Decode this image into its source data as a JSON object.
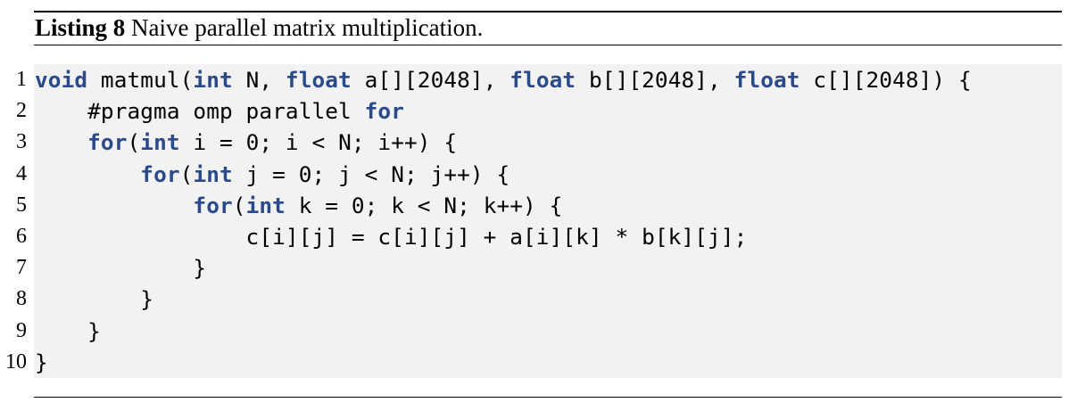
{
  "caption": {
    "label": "Listing",
    "number": "8",
    "text": "Naive parallel matrix multiplication."
  },
  "colors": {
    "keyword": "#2a4a8a",
    "code_background": "#f2f2f2",
    "text": "#000000"
  },
  "code_lines": [
    {
      "number": "1",
      "tokens": [
        {
          "t": "void",
          "kw": true
        },
        {
          "t": " matmul("
        },
        {
          "t": "int",
          "kw": true
        },
        {
          "t": " N, "
        },
        {
          "t": "float",
          "kw": true
        },
        {
          "t": " a[][2048], "
        },
        {
          "t": "float",
          "kw": true
        },
        {
          "t": " b[][2048], "
        },
        {
          "t": "float",
          "kw": true
        },
        {
          "t": " c[][2048]) {"
        }
      ]
    },
    {
      "number": "2",
      "tokens": [
        {
          "t": "    #pragma omp parallel "
        },
        {
          "t": "for",
          "kw": true
        }
      ]
    },
    {
      "number": "3",
      "tokens": [
        {
          "t": "    "
        },
        {
          "t": "for",
          "kw": true
        },
        {
          "t": "("
        },
        {
          "t": "int",
          "kw": true
        },
        {
          "t": " i = 0; i < N; i++) {"
        }
      ]
    },
    {
      "number": "4",
      "tokens": [
        {
          "t": "        "
        },
        {
          "t": "for",
          "kw": true
        },
        {
          "t": "("
        },
        {
          "t": "int",
          "kw": true
        },
        {
          "t": " j = 0; j < N; j++) {"
        }
      ]
    },
    {
      "number": "5",
      "tokens": [
        {
          "t": "            "
        },
        {
          "t": "for",
          "kw": true
        },
        {
          "t": "("
        },
        {
          "t": "int",
          "kw": true
        },
        {
          "t": " k = 0; k < N; k++) {"
        }
      ]
    },
    {
      "number": "6",
      "tokens": [
        {
          "t": "                c[i][j] = c[i][j] + a[i][k] * b[k][j];"
        }
      ]
    },
    {
      "number": "7",
      "tokens": [
        {
          "t": "            }"
        }
      ]
    },
    {
      "number": "8",
      "tokens": [
        {
          "t": "        }"
        }
      ]
    },
    {
      "number": "9",
      "tokens": [
        {
          "t": "    }"
        }
      ]
    },
    {
      "number": "10",
      "tokens": [
        {
          "t": "}"
        }
      ]
    }
  ]
}
